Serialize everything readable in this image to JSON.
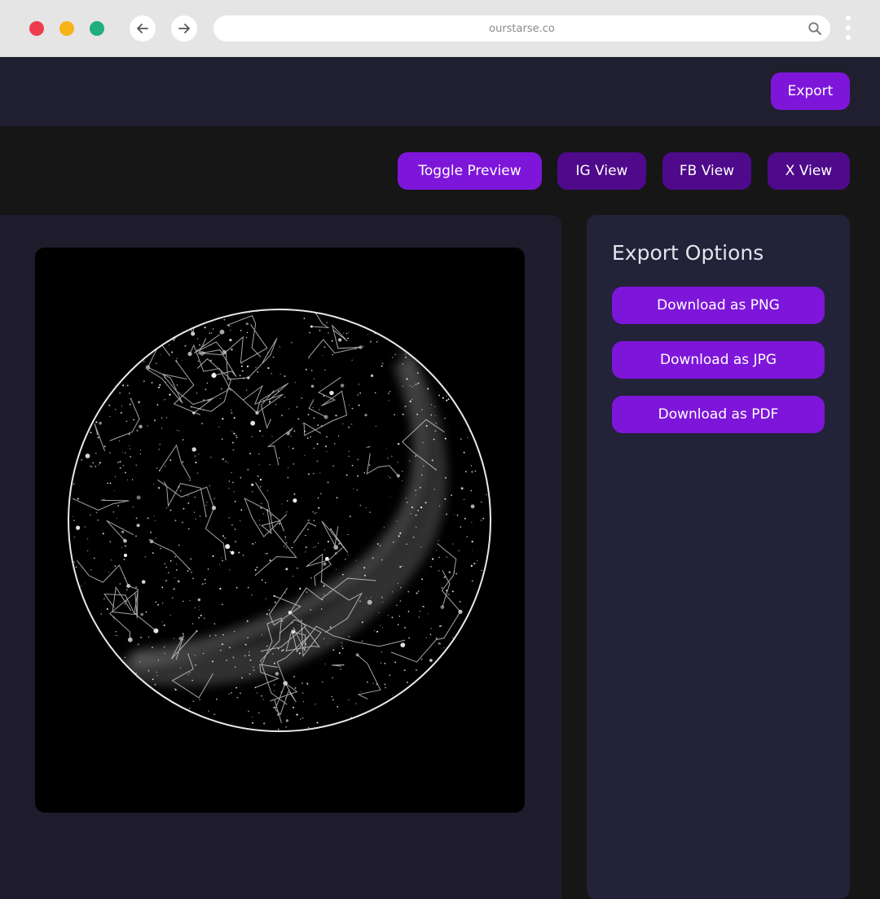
{
  "browser": {
    "url": "ourstarse.co",
    "traffic_light_colors": [
      "#ee3c4e",
      "#f7b216",
      "#1fae7d"
    ],
    "icons": [
      "back-arrow-icon",
      "forward-arrow-icon",
      "search-icon",
      "kebab-menu-icon"
    ]
  },
  "header": {
    "export_label": "Export"
  },
  "toolbar": {
    "toggle_preview_label": "Toggle Preview",
    "ig_view_label": "IG View",
    "fb_view_label": "FB View",
    "x_view_label": "X View"
  },
  "export_panel": {
    "title": "Export Options",
    "png_label": "Download as PNG",
    "jpg_label": "Download as JPG",
    "pdf_label": "Download as PDF"
  },
  "colors": {
    "accent": "#7e16da",
    "accent_dark": "#4e0a8a",
    "header_bg": "#201f30",
    "page_bg": "#161616",
    "panel_bg": "#1e1c2c",
    "side_panel_bg": "#222238"
  }
}
